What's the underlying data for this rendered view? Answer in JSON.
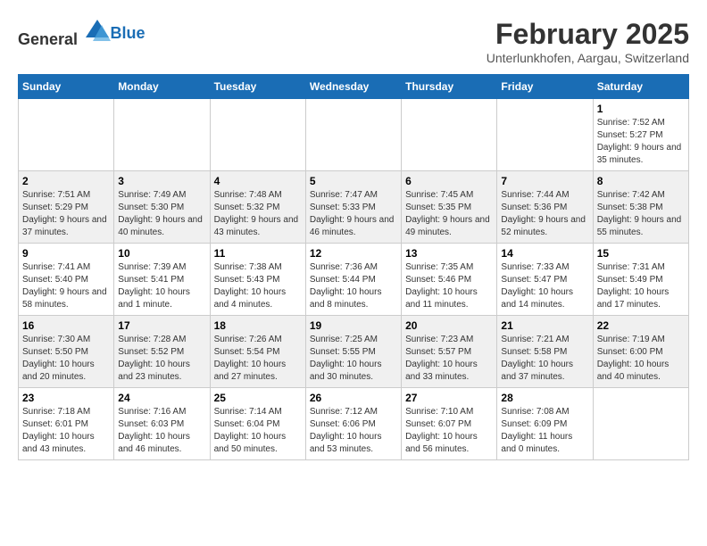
{
  "logo": {
    "general": "General",
    "blue": "Blue"
  },
  "header": {
    "month": "February 2025",
    "location": "Unterlunkhofen, Aargau, Switzerland"
  },
  "weekdays": [
    "Sunday",
    "Monday",
    "Tuesday",
    "Wednesday",
    "Thursday",
    "Friday",
    "Saturday"
  ],
  "weeks": [
    [
      {
        "day": "",
        "info": ""
      },
      {
        "day": "",
        "info": ""
      },
      {
        "day": "",
        "info": ""
      },
      {
        "day": "",
        "info": ""
      },
      {
        "day": "",
        "info": ""
      },
      {
        "day": "",
        "info": ""
      },
      {
        "day": "1",
        "info": "Sunrise: 7:52 AM\nSunset: 5:27 PM\nDaylight: 9 hours and 35 minutes."
      }
    ],
    [
      {
        "day": "2",
        "info": "Sunrise: 7:51 AM\nSunset: 5:29 PM\nDaylight: 9 hours and 37 minutes."
      },
      {
        "day": "3",
        "info": "Sunrise: 7:49 AM\nSunset: 5:30 PM\nDaylight: 9 hours and 40 minutes."
      },
      {
        "day": "4",
        "info": "Sunrise: 7:48 AM\nSunset: 5:32 PM\nDaylight: 9 hours and 43 minutes."
      },
      {
        "day": "5",
        "info": "Sunrise: 7:47 AM\nSunset: 5:33 PM\nDaylight: 9 hours and 46 minutes."
      },
      {
        "day": "6",
        "info": "Sunrise: 7:45 AM\nSunset: 5:35 PM\nDaylight: 9 hours and 49 minutes."
      },
      {
        "day": "7",
        "info": "Sunrise: 7:44 AM\nSunset: 5:36 PM\nDaylight: 9 hours and 52 minutes."
      },
      {
        "day": "8",
        "info": "Sunrise: 7:42 AM\nSunset: 5:38 PM\nDaylight: 9 hours and 55 minutes."
      }
    ],
    [
      {
        "day": "9",
        "info": "Sunrise: 7:41 AM\nSunset: 5:40 PM\nDaylight: 9 hours and 58 minutes."
      },
      {
        "day": "10",
        "info": "Sunrise: 7:39 AM\nSunset: 5:41 PM\nDaylight: 10 hours and 1 minute."
      },
      {
        "day": "11",
        "info": "Sunrise: 7:38 AM\nSunset: 5:43 PM\nDaylight: 10 hours and 4 minutes."
      },
      {
        "day": "12",
        "info": "Sunrise: 7:36 AM\nSunset: 5:44 PM\nDaylight: 10 hours and 8 minutes."
      },
      {
        "day": "13",
        "info": "Sunrise: 7:35 AM\nSunset: 5:46 PM\nDaylight: 10 hours and 11 minutes."
      },
      {
        "day": "14",
        "info": "Sunrise: 7:33 AM\nSunset: 5:47 PM\nDaylight: 10 hours and 14 minutes."
      },
      {
        "day": "15",
        "info": "Sunrise: 7:31 AM\nSunset: 5:49 PM\nDaylight: 10 hours and 17 minutes."
      }
    ],
    [
      {
        "day": "16",
        "info": "Sunrise: 7:30 AM\nSunset: 5:50 PM\nDaylight: 10 hours and 20 minutes."
      },
      {
        "day": "17",
        "info": "Sunrise: 7:28 AM\nSunset: 5:52 PM\nDaylight: 10 hours and 23 minutes."
      },
      {
        "day": "18",
        "info": "Sunrise: 7:26 AM\nSunset: 5:54 PM\nDaylight: 10 hours and 27 minutes."
      },
      {
        "day": "19",
        "info": "Sunrise: 7:25 AM\nSunset: 5:55 PM\nDaylight: 10 hours and 30 minutes."
      },
      {
        "day": "20",
        "info": "Sunrise: 7:23 AM\nSunset: 5:57 PM\nDaylight: 10 hours and 33 minutes."
      },
      {
        "day": "21",
        "info": "Sunrise: 7:21 AM\nSunset: 5:58 PM\nDaylight: 10 hours and 37 minutes."
      },
      {
        "day": "22",
        "info": "Sunrise: 7:19 AM\nSunset: 6:00 PM\nDaylight: 10 hours and 40 minutes."
      }
    ],
    [
      {
        "day": "23",
        "info": "Sunrise: 7:18 AM\nSunset: 6:01 PM\nDaylight: 10 hours and 43 minutes."
      },
      {
        "day": "24",
        "info": "Sunrise: 7:16 AM\nSunset: 6:03 PM\nDaylight: 10 hours and 46 minutes."
      },
      {
        "day": "25",
        "info": "Sunrise: 7:14 AM\nSunset: 6:04 PM\nDaylight: 10 hours and 50 minutes."
      },
      {
        "day": "26",
        "info": "Sunrise: 7:12 AM\nSunset: 6:06 PM\nDaylight: 10 hours and 53 minutes."
      },
      {
        "day": "27",
        "info": "Sunrise: 7:10 AM\nSunset: 6:07 PM\nDaylight: 10 hours and 56 minutes."
      },
      {
        "day": "28",
        "info": "Sunrise: 7:08 AM\nSunset: 6:09 PM\nDaylight: 11 hours and 0 minutes."
      },
      {
        "day": "",
        "info": ""
      }
    ]
  ]
}
